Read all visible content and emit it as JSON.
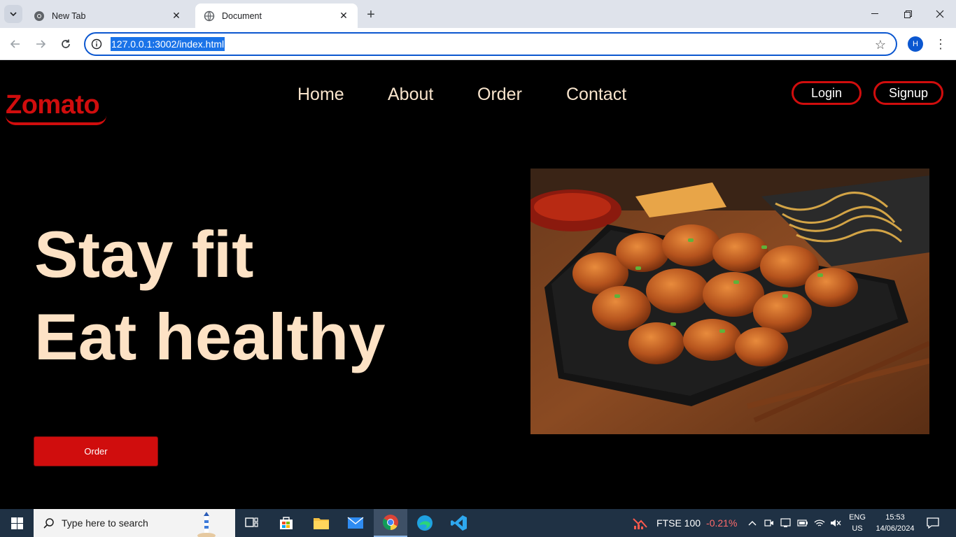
{
  "browser": {
    "tabs": [
      {
        "title": "New Tab",
        "active": false
      },
      {
        "title": "Document",
        "active": true
      }
    ],
    "url": "127.0.0.1:3002/index.html",
    "profile_initial": "H"
  },
  "site": {
    "logo": "Zomato",
    "nav": [
      "Home",
      "About",
      "Order",
      "Contact"
    ],
    "auth": {
      "login": "Login",
      "signup": "Signup"
    },
    "hero": {
      "line1": "Stay fit",
      "line2": "Eat healthy"
    },
    "cta": "Order",
    "colors": {
      "brand": "#d00d0d",
      "hero_text": "#fde2c5",
      "background": "#000000"
    }
  },
  "taskbar": {
    "search_placeholder": "Type here to search",
    "ticker": {
      "name": "FTSE 100",
      "change": "-0.21%"
    },
    "lang": {
      "line1": "ENG",
      "line2": "US"
    },
    "clock": {
      "time": "15:53",
      "date": "14/06/2024"
    }
  }
}
